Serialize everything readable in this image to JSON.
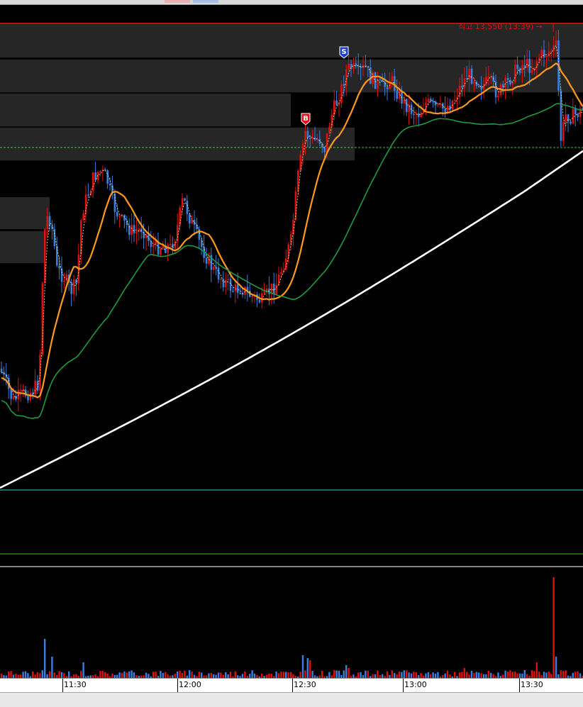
{
  "chart_data": {
    "type": "candlestick",
    "max_label": "최고 13,550 (13:39) →",
    "x_ticks": [
      "11:30",
      "12:00",
      "12:30",
      "13:00",
      "13:30"
    ],
    "signals": [
      {
        "label": "B",
        "time": "12:33"
      },
      {
        "label": "S",
        "time": "12:43"
      }
    ],
    "colors": {
      "up": "#e01010",
      "down": "#3a7fe0",
      "ma_fast": "#ff9a1a",
      "ma_mid": "#1f9a3f",
      "ma_slow": "#ffffff",
      "ma_tick": "#f0f0a0",
      "resistance_line": "#e01010",
      "reference_line": "#35c835",
      "sub_line_cyan": "#40c8d8",
      "sub_line_green": "#35c835"
    },
    "series": [
      {
        "name": "",
        "color": "orange"
      },
      {
        "name": "",
        "color": "green"
      },
      {
        "name": "",
        "color": "white"
      }
    ]
  }
}
